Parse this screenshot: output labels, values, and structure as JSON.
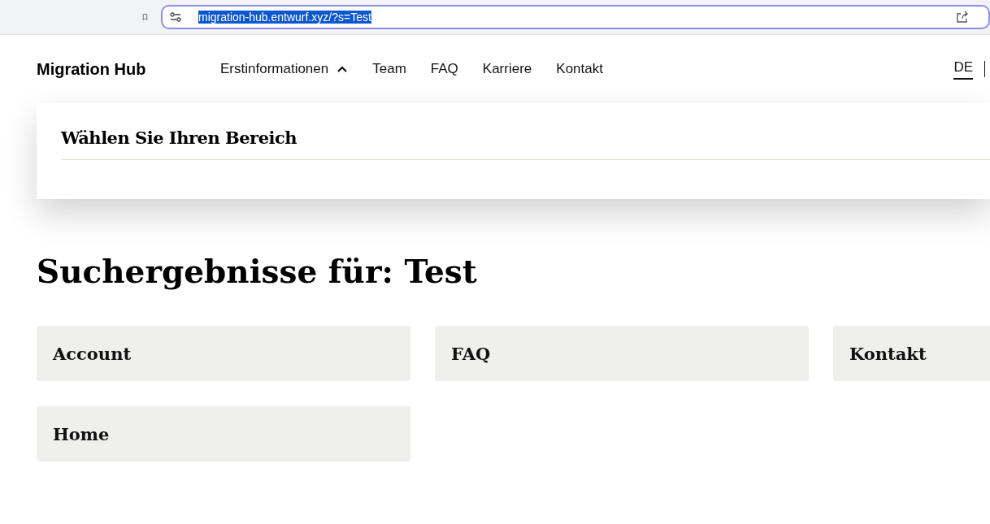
{
  "browser": {
    "url": "migration-hub.entwurf.xyz/?s=Test",
    "url_selected": true
  },
  "header": {
    "logo": "Migration Hub",
    "nav": [
      {
        "label": "Erstinformationen",
        "kind": "dropdown",
        "expanded": true
      },
      {
        "label": "Team",
        "kind": "link"
      },
      {
        "label": "FAQ",
        "kind": "link"
      },
      {
        "label": "Karriere",
        "kind": "link"
      },
      {
        "label": "Kontakt",
        "kind": "link"
      }
    ],
    "languages": [
      {
        "label": "DE",
        "selected": true
      }
    ]
  },
  "dropdown_panel": {
    "title": "Wählen Sie Ihren Bereich"
  },
  "search": {
    "heading": "Suchergebnisse für: Test",
    "results": [
      {
        "title": "Account"
      },
      {
        "title": "FAQ"
      },
      {
        "title": "Kontakt"
      },
      {
        "title": "Home"
      }
    ]
  }
}
